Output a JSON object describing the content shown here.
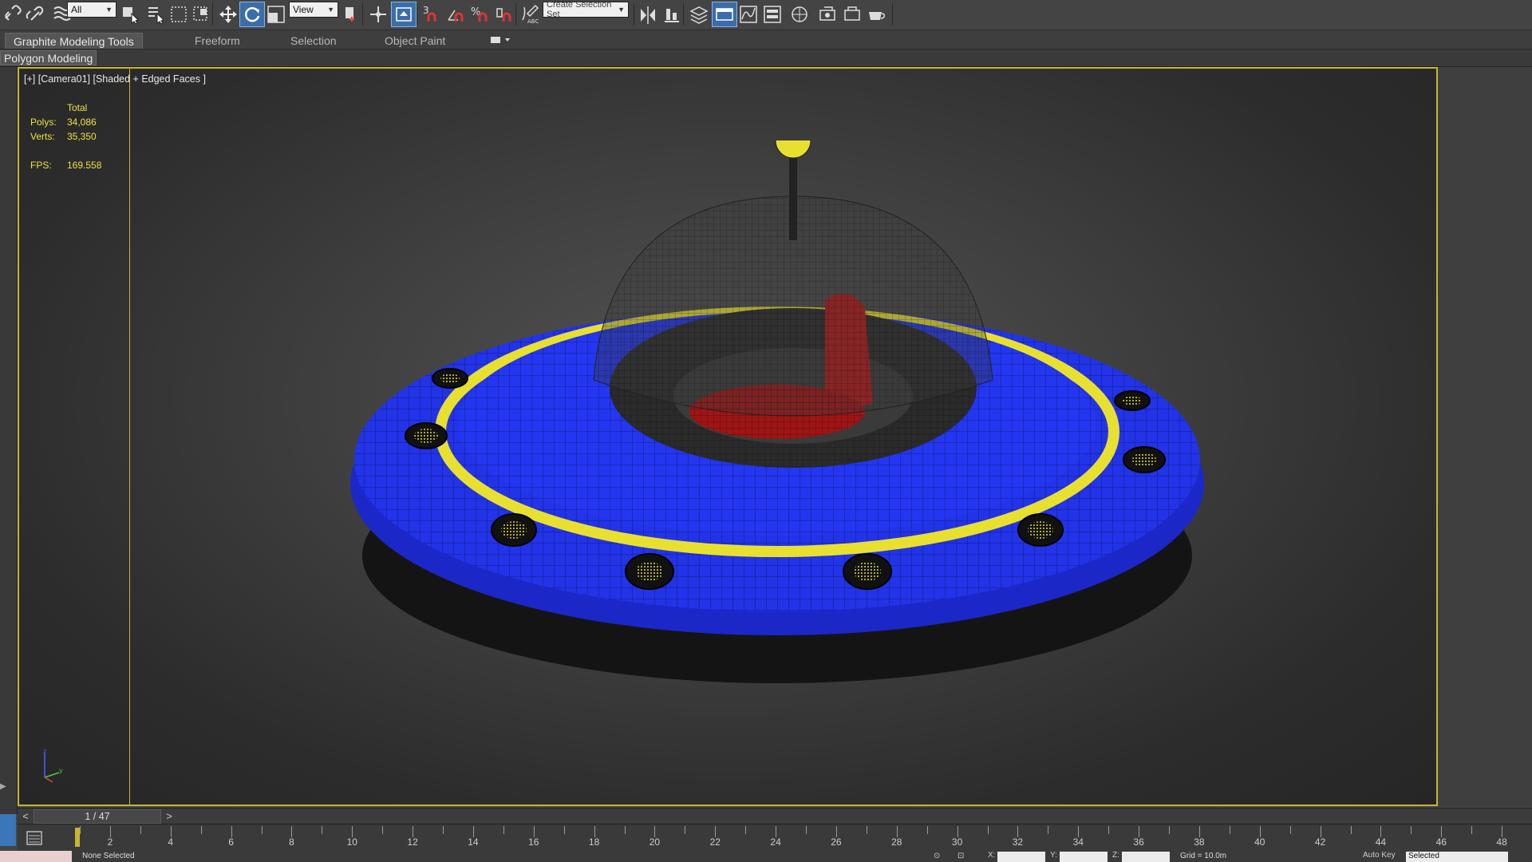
{
  "toolbar": {
    "filter_value": "All",
    "ref_coord_value": "View",
    "snap_label": "3",
    "percent_snap_label": "%",
    "selection_set_placeholder": "Create Selection Set",
    "icons": [
      "link-icon",
      "unlink-icon",
      "bind-spacewarp-icon",
      "select-object-icon",
      "select-by-name-icon",
      "rect-region-icon",
      "window-crossing-icon",
      "move-icon",
      "rotate-icon",
      "scale-icon",
      "pivot-icon",
      "select-manipulate-icon",
      "keyboard-shortcut-icon",
      "snap-toggle-icon",
      "angle-snap-icon",
      "percent-snap-icon",
      "spinner-snap-icon",
      "edit-named-sets-icon",
      "mirror-icon",
      "align-icon",
      "layer-manager-icon",
      "graphite-toggle-icon",
      "curve-editor-icon",
      "schematic-view-icon",
      "material-editor-icon",
      "render-setup-icon",
      "rendered-frame-icon",
      "render-icon"
    ]
  },
  "ribbon": {
    "tabs": [
      "Graphite Modeling Tools",
      "Freeform",
      "Selection",
      "Object Paint"
    ],
    "active_tab": "Graphite Modeling Tools"
  },
  "panel": {
    "tab_label": "Polygon Modeling"
  },
  "viewport": {
    "label": "[+] [Camera01] [Shaded + Edged Faces ]",
    "stats": {
      "header": "Total",
      "polys_label": "Polys:",
      "polys_value": "34,086",
      "verts_label": "Verts:",
      "verts_value": "35,350",
      "fps_label": "FPS:",
      "fps_value": "169.558"
    },
    "colors": {
      "frame": "#c8b530",
      "body": "#1f2ee6",
      "ring": "#e8e030",
      "seat": "#b01818"
    }
  },
  "time_slider": {
    "prev": "<",
    "position": "1 / 47",
    "next": ">"
  },
  "trackbar": {
    "labels": [
      "2",
      "4",
      "6",
      "8",
      "10",
      "12",
      "14",
      "16",
      "18",
      "20",
      "22",
      "24",
      "26",
      "28",
      "30",
      "32",
      "34",
      "36",
      "38",
      "40",
      "42",
      "44",
      "46",
      "48"
    ]
  },
  "status": {
    "selection": "None Selected",
    "x_label": "X:",
    "y_label": "Y:",
    "z_label": "Z:",
    "grid": "Grid = 10.0m",
    "auto_key": "Auto Key",
    "key_mode": "Selected"
  }
}
